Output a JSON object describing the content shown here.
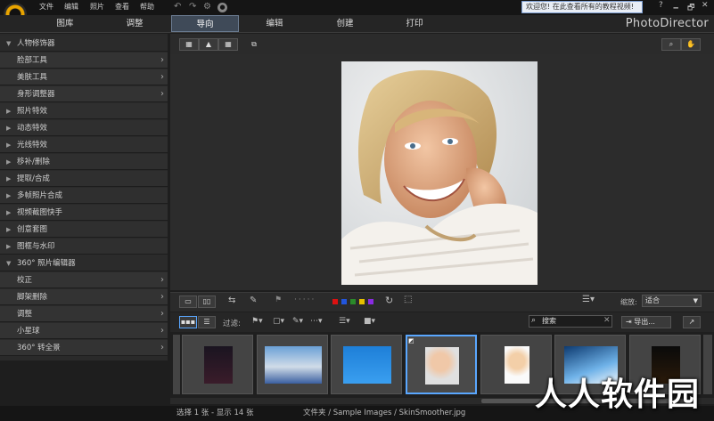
{
  "menu": [
    "文件",
    "编辑",
    "照片",
    "查看",
    "帮助"
  ],
  "welcome_text": "欢迎您! 在此查看所有的教程视频!",
  "window_buttons": [
    "?",
    "🗕",
    "🗗",
    "✕"
  ],
  "tabs": [
    {
      "label": "图库",
      "active": false
    },
    {
      "label": "调整",
      "active": false
    },
    {
      "label": "导向",
      "active": true
    },
    {
      "label": "编辑",
      "active": false
    },
    {
      "label": "创建",
      "active": false
    },
    {
      "label": "打印",
      "active": false
    }
  ],
  "brand": "PhotoDirector",
  "left_panel": {
    "head": "人物修饰器",
    "portrait_tools": [
      "脸部工具",
      "美肤工具",
      "身形调整器"
    ],
    "sections": [
      "照片特效",
      "动态特效",
      "光线特效",
      "移补/删除",
      "提取/合成",
      "多帧照片合成",
      "视频截图快手",
      "创意套图",
      "图框与水印"
    ],
    "section_360": "360° 照片编辑器",
    "tools_360": [
      "校正",
      "脚架删除",
      "调整",
      "小星球",
      "360° 转全景"
    ]
  },
  "bottom_toolbar": {
    "filter_label": "过滤:",
    "zoom_label": "缩放:",
    "zoom_value": "适合",
    "search_placeholder": "搜索",
    "export_label": "导出..."
  },
  "color_labels": [
    "#d11",
    "#2255dd",
    "#2a8a2a",
    "#e6c000",
    "#8a2be2"
  ],
  "status": {
    "selection": "选择 1 张 - 显示 14 张",
    "path": "文件夹 / Sample Images / SkinSmoother.jpg"
  },
  "watermark": "人人软件园"
}
